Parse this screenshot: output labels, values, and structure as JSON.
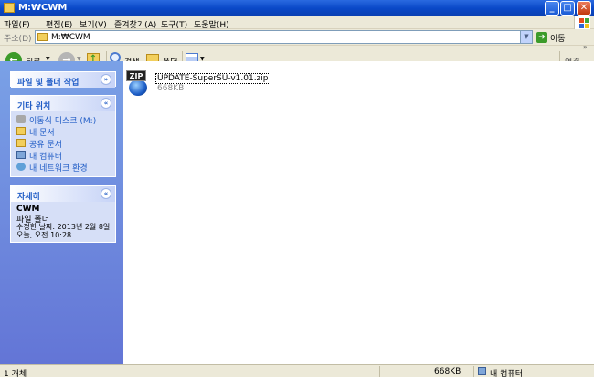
{
  "window": {
    "title": "M:₩CWM"
  },
  "menu": [
    "파일(F)",
    "편집(E)",
    "보기(V)",
    "즐겨찾기(A)",
    "도구(T)",
    "도움말(H)"
  ],
  "address": {
    "label": "주소(D)",
    "value": "M:₩CWM",
    "go_label": "이동"
  },
  "toolbar": {
    "back_label": "뒤로",
    "search_label": "검색",
    "folders_label": "폴더",
    "links_label": "연결"
  },
  "tasks": {
    "file_folder": {
      "title": "파일 및 폴더 작업"
    },
    "other_places": {
      "title": "기타 위치",
      "items": [
        {
          "label": "이동식 디스크 (M:)",
          "icon": "drive-icon"
        },
        {
          "label": "내 문서",
          "icon": "documents-icon"
        },
        {
          "label": "공유 문서",
          "icon": "shared-folder-icon"
        },
        {
          "label": "내 컴퓨터",
          "icon": "computer-icon"
        },
        {
          "label": "내 네트워크 환경",
          "icon": "network-icon"
        }
      ]
    },
    "details": {
      "title": "자세히",
      "name": "CWM",
      "type": "파일 폴더",
      "modified": "수정한 날짜: 2013년 2월 8일 오늘, 오전 10:28"
    }
  },
  "files": [
    {
      "name": "UPDATE-SuperSU-v1.01.zip",
      "size": "668KB",
      "icon": "zip-icon"
    }
  ],
  "status": {
    "count": "1 개체",
    "size": "668KB",
    "location": "내 컴퓨터"
  },
  "colors": {
    "title_bar": "#0a49c8",
    "sidebar": "#6375d6",
    "link": "#215dc6"
  }
}
